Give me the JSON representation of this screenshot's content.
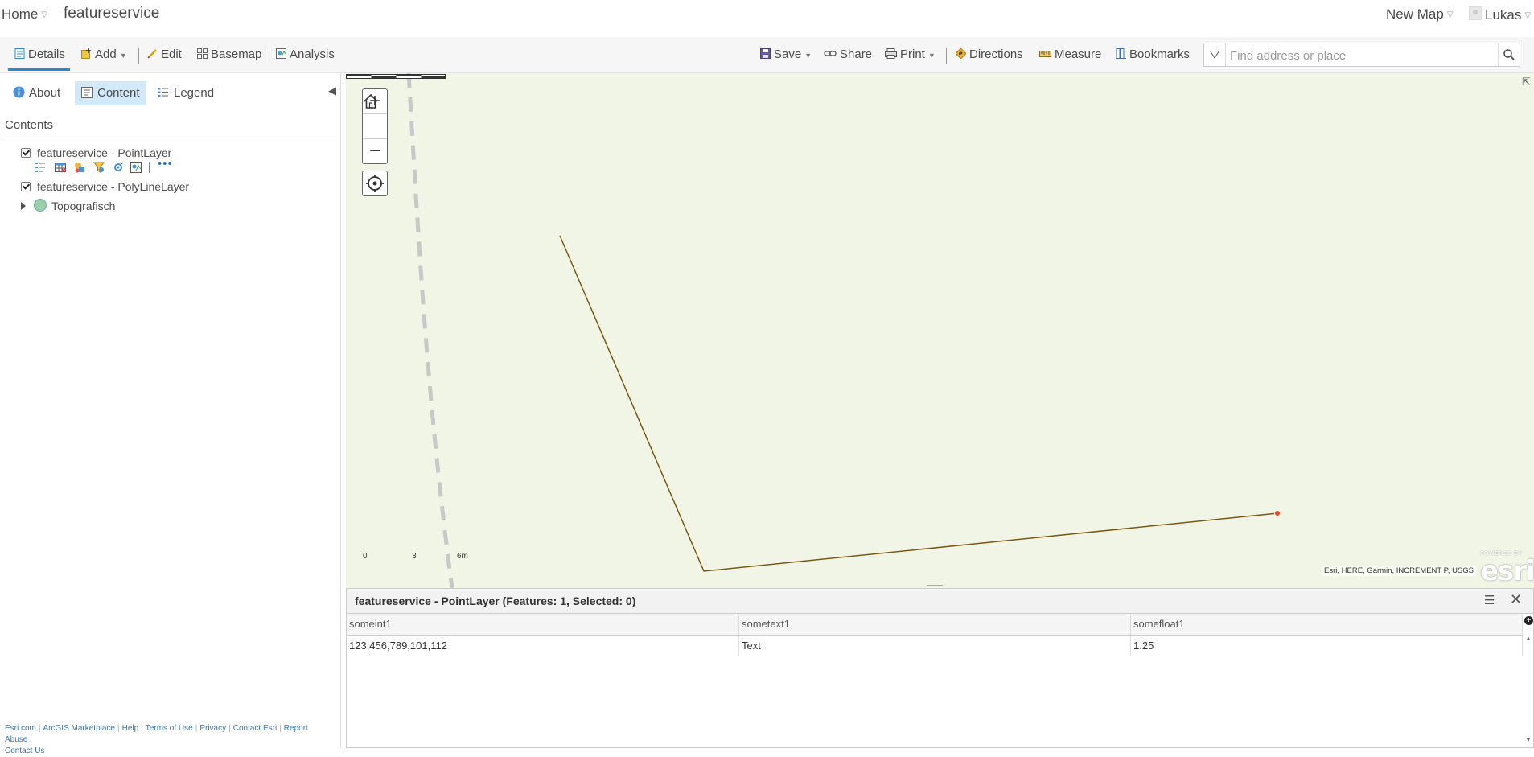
{
  "header": {
    "home_label": "Home",
    "map_title": "featureservice",
    "new_map_label": "New Map",
    "user_name": "Lukas"
  },
  "toolbar": {
    "details": "Details",
    "add": "Add",
    "edit": "Edit",
    "basemap": "Basemap",
    "analysis": "Analysis",
    "save": "Save",
    "share": "Share",
    "print": "Print",
    "directions": "Directions",
    "measure": "Measure",
    "bookmarks": "Bookmarks",
    "search_placeholder": "Find address or place"
  },
  "left_panel": {
    "tabs": [
      "About",
      "Content",
      "Legend"
    ],
    "active_tab": "Content",
    "contents_title": "Contents",
    "layers": [
      {
        "name": "featureservice - PointLayer",
        "checked": true
      },
      {
        "name": "featureservice - PolyLineLayer",
        "checked": true
      }
    ],
    "basemap_layer": "Topografisch",
    "footer_links": [
      "Esri.com",
      "ArcGIS Marketplace",
      "Help",
      "Terms of Use",
      "Privacy",
      "Contact Esri",
      "Report Abuse",
      "Contact Us"
    ]
  },
  "map": {
    "background_color": "#f1f5e6",
    "line_color": "#7a5a14",
    "point_color": "#e8502a",
    "scale_labels": [
      "0",
      "3",
      "6m"
    ],
    "attribution": "Esri, HERE, Garmin, INCREMENT P, USGS",
    "powered_by": "POWERED BY",
    "logo_text": "esri"
  },
  "attribute_table": {
    "title": "featureservice - PointLayer (Features: 1, Selected: 0)",
    "columns": [
      "someint1",
      "sometext1",
      "somefloat1"
    ],
    "rows": [
      [
        "123,456,789,101,112",
        "Text",
        "1.25"
      ]
    ]
  },
  "colors": {
    "accent": "#2e88c8",
    "active_tab_bg": "#d2e9f9",
    "link": "#2e77b8"
  }
}
